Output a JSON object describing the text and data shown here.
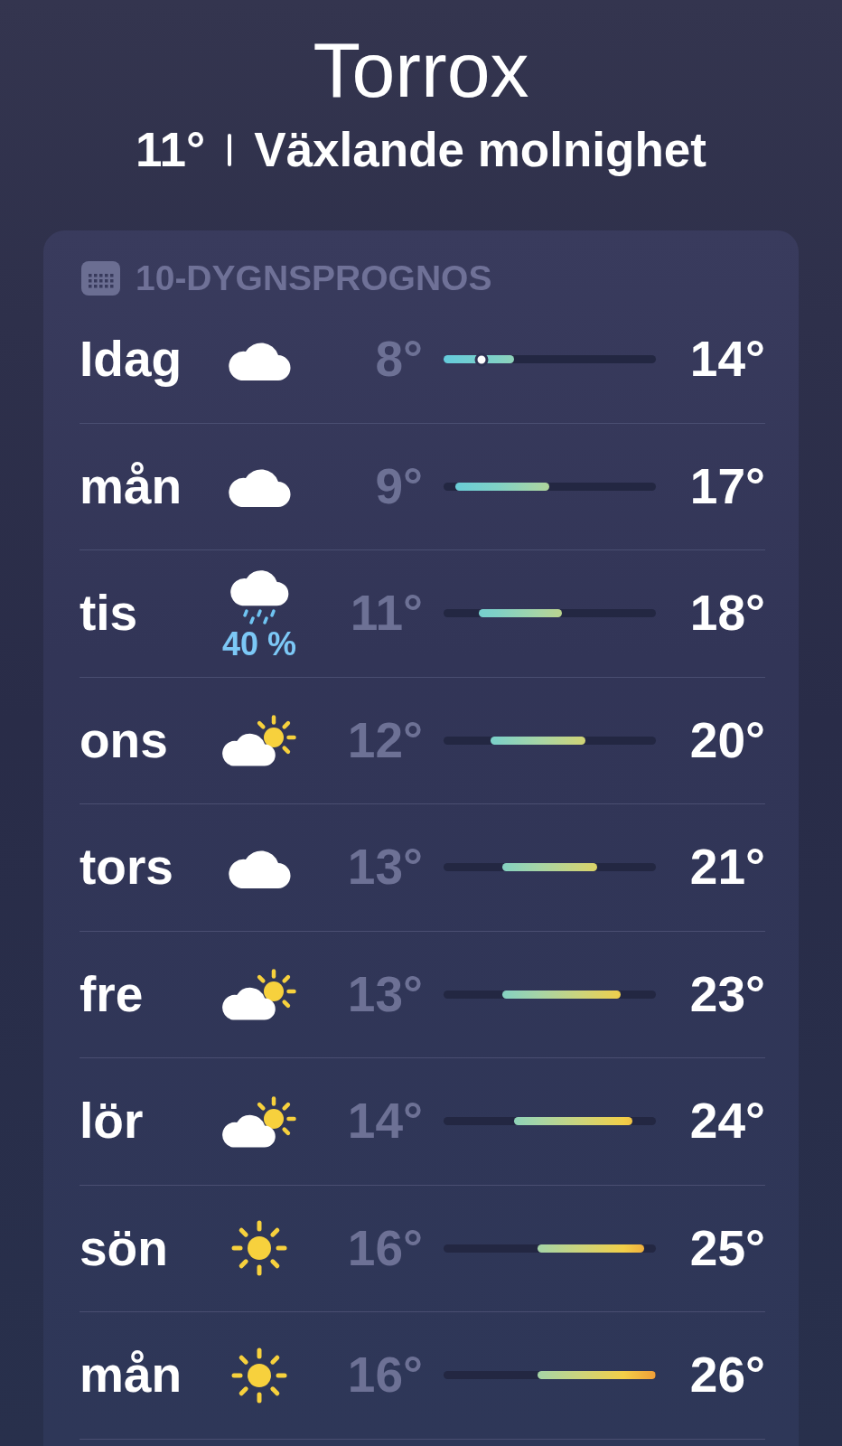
{
  "location": {
    "name": "Torrox"
  },
  "current": {
    "temperature": "11°",
    "condition": "Växlande molnighet"
  },
  "forecast": {
    "title": "10-DYGNSPROGNOS",
    "days": [
      {
        "day": "Idag",
        "kind": "cloud",
        "low": "8°",
        "high": "14°",
        "current": {
          "level": 0.179
        }
      },
      {
        "day": "mån",
        "kind": "cloud",
        "low": "9°",
        "high": "17°"
      },
      {
        "day": "tis",
        "kind": "rain",
        "precipitation": "40 %",
        "low": "11°",
        "high": "18°"
      },
      {
        "day": "ons",
        "kind": "sun-cloud",
        "low": "12°",
        "high": "20°"
      },
      {
        "day": "tors",
        "kind": "cloud",
        "low": "13°",
        "high": "21°"
      },
      {
        "day": "fre",
        "kind": "sun-cloud",
        "low": "13°",
        "high": "23°"
      },
      {
        "day": "lör",
        "kind": "sun-cloud",
        "low": "14°",
        "high": "24°"
      },
      {
        "day": "sön",
        "kind": "sun",
        "low": "16°",
        "high": "25°"
      },
      {
        "day": "mån",
        "kind": "sun",
        "low": "16°",
        "high": "26°"
      }
    ]
  }
}
